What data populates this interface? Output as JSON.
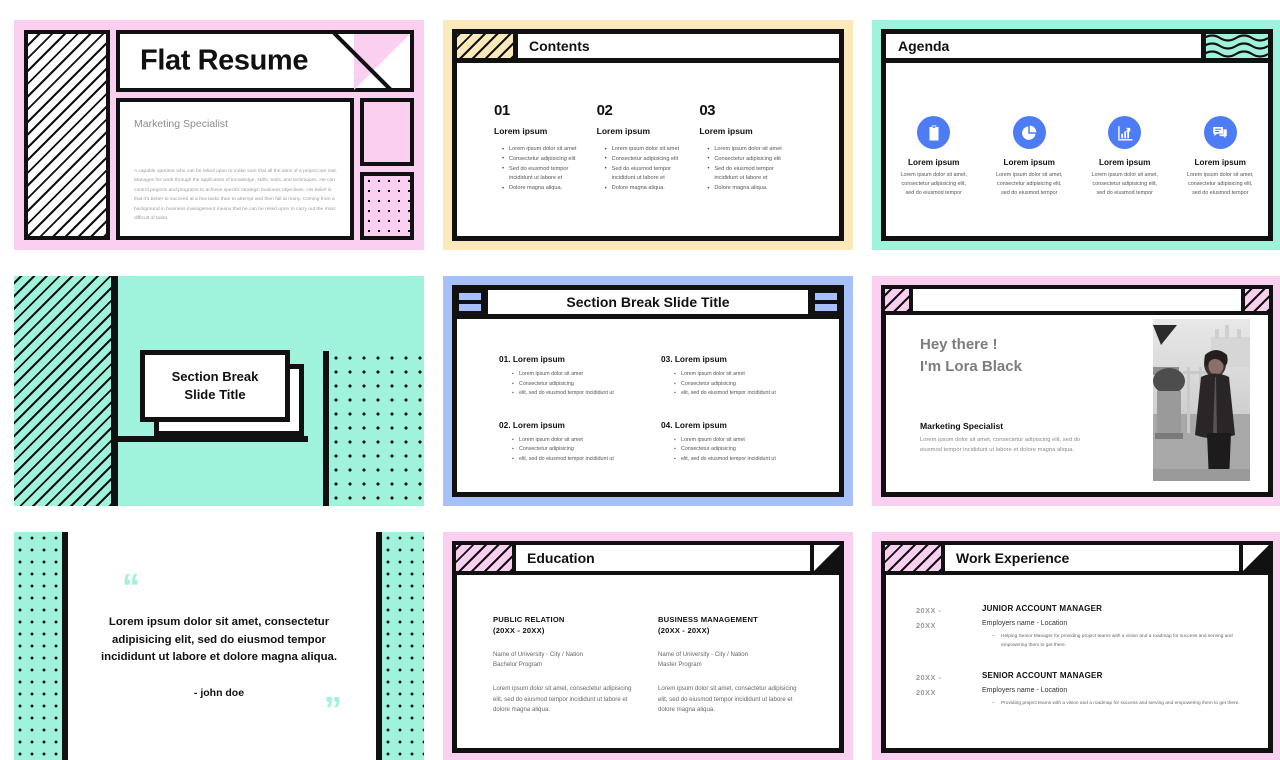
{
  "palette": {
    "pink": "#fbcfef",
    "cream": "#fbe9bc",
    "mint": "#9ff2dc",
    "periwinkle": "#a8c0fa",
    "icon_blue": "#4d7cf5",
    "ink": "#111111"
  },
  "slide1": {
    "title": "Flat Resume",
    "role": "Marketing Specialist",
    "paragraph": "A capable operator who can be relied upon to make sure that all the aims of a project are met. Manages his work through the application of knowledge, skills, tools, and techniques. He can control projects and programs to achieve specific strategic business objectives. His belief is that it's better to succeed at a few tasks than to attempt and then fail at many. Coming from a background in business management means that he can be relied upon to carry out the most difficult of tasks."
  },
  "slide2": {
    "heading": "Contents",
    "columns": [
      {
        "number": "01",
        "subtitle": "Lorem ipsum",
        "bullets": [
          "Lorem ipsum dolor sit amet",
          "Consectetur adipisicing elit",
          "Sed do eiusmod tempor incididunt ut labore et",
          "Dolore magna aliqua."
        ]
      },
      {
        "number": "02",
        "subtitle": "Lorem ipsum",
        "bullets": [
          "Lorem ipsum dolor sit amet",
          "Consectetur adipisicing elit",
          "Sed do eiusmod tempor incididunt ut labore et",
          "Dolore magna aliqua."
        ]
      },
      {
        "number": "03",
        "subtitle": "Lorem ipsum",
        "bullets": [
          "Lorem ipsum dolor sit amet",
          "Consectetur adipisicing elit",
          "Sed do eiusmod tempor incididunt ut labore et",
          "Dolore magna aliqua."
        ]
      }
    ]
  },
  "slide3": {
    "heading": "Agenda",
    "items": [
      {
        "icon": "clipboard-checklist-icon",
        "title": "Lorem ipsum",
        "desc": "Lorem ipsum dolor sit amet, consectetur adipisicing elit, sed do eiusmod tempor"
      },
      {
        "icon": "pie-chart-icon",
        "title": "Lorem ipsum",
        "desc": "Lorem ipsum dolor sit amet, consectetur adipisicing elit, sed do eiusmod tempor"
      },
      {
        "icon": "bar-chart-growth-icon",
        "title": "Lorem ipsum",
        "desc": "Lorem ipsum dolor sit amet, consectetur adipisicing elit, sed do eiusmod tempor"
      },
      {
        "icon": "chat-bubbles-icon",
        "title": "Lorem ipsum",
        "desc": "Lorem ipsum dolor sit amet, consectetur adipisicing elit, sed do eiusmod tempor"
      }
    ]
  },
  "slide4": {
    "title_line1": "Section Break",
    "title_line2": "Slide Title"
  },
  "slide5": {
    "heading": "Section Break Slide Title",
    "items": [
      {
        "title": "01. Lorem ipsum",
        "bullets": [
          "Lorem ipsum dolor sit amet",
          "Consectetur adipisicing",
          "elit, sed do eiusmod tempor incididunt ut"
        ]
      },
      {
        "title": "03. Lorem ipsum",
        "bullets": [
          "Lorem ipsum dolor sit amet",
          "Consectetur adipisicing",
          "elit, sed do eiusmod tempor incididunt ut"
        ]
      },
      {
        "title": "02. Lorem ipsum",
        "bullets": [
          "Lorem ipsum dolor sit amet",
          "Consectetur adipisicing",
          "elit, sed do eiusmod tempor incididunt ut"
        ]
      },
      {
        "title": "04. Lorem ipsum",
        "bullets": [
          "Lorem ipsum dolor sit amet",
          "Consectetur adipisicing",
          "elit, sed do eiusmod tempor incididunt ut"
        ]
      }
    ]
  },
  "slide6": {
    "greeting_line1": "Hey there !",
    "greeting_line2": "I'm Lora Black",
    "role": "Marketing Specialist",
    "desc": "Lorem ipsum dolor sit amet, consectetur adipiscing elit, sed do eiusmod tempor incididunt ut labore et dolore magna aliqua.",
    "photo_alt": "portrait-photo"
  },
  "slide7": {
    "quote_open": "“",
    "quote": "Lorem ipsum dolor sit amet, consectetur adipisicing elit, sed do eiusmod tempor incididunt ut labore et dolore magna aliqua.",
    "author": "- john doe",
    "quote_close": "”"
  },
  "slide8": {
    "heading": "Education",
    "columns": [
      {
        "title": "PUBLIC RELATION\n(20XX - 20XX)",
        "university": "Name of University - City / Nation\nBachelor Program",
        "desc": "Lorem ipsum dolor sit amet, consectetur adipisicing elit, sed do eiusmod tempor incididunt ut labore et dolore magna aliqua."
      },
      {
        "title": "BUSINESS MANAGEMENT\n(20XX - 20XX)",
        "university": "Name of University - City / Nation\nMaster Program",
        "desc": "Lorem ipsum dolor sit amet, consectetur adipisicing elit, sed do eiusmod tempor incididunt ut labore et dolore magna aliqua."
      }
    ]
  },
  "slide9": {
    "heading": "Work Experience",
    "rows": [
      {
        "years": "20XX -\n20XX",
        "role": "JUNIOR ACCOUNT MANAGER",
        "employer": "Employers name - Location",
        "bullets": [
          "Helping Senior Manager for providing project teams with a vision and a roadmap for success and serving and empowering them to get there."
        ]
      },
      {
        "years": "20XX -\n20XX",
        "role": "SENIOR ACCOUNT MANAGER",
        "employer": "Employers name - Location",
        "bullets": [
          "Providing project teams with a vision and a roadmap for success and serving and empowering them to get there."
        ]
      }
    ]
  }
}
